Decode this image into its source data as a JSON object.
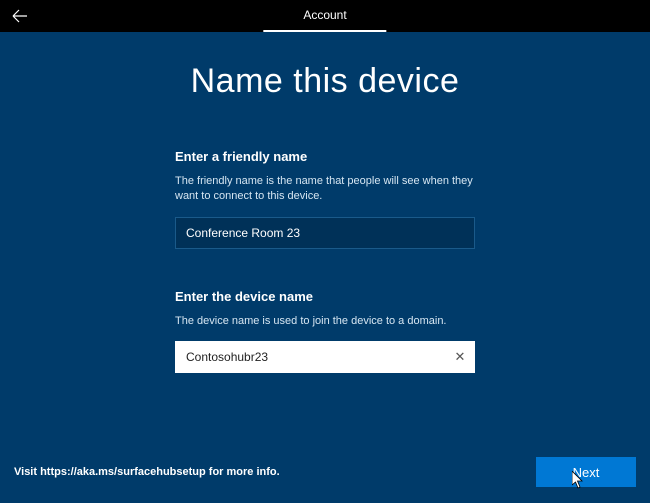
{
  "topbar": {
    "tab_label": "Account"
  },
  "page": {
    "title": "Name this device"
  },
  "friendly": {
    "label": "Enter a friendly name",
    "description": "The friendly name is the name that people will see when they want to connect to this device.",
    "value": "Conference Room 23"
  },
  "device": {
    "label": "Enter the device name",
    "description": "The device name is used to join the device to a domain.",
    "value": "Contosohubr23"
  },
  "footer": {
    "info": "Visit https://aka.ms/surfacehubsetup for more info.",
    "next_label": "Next"
  }
}
